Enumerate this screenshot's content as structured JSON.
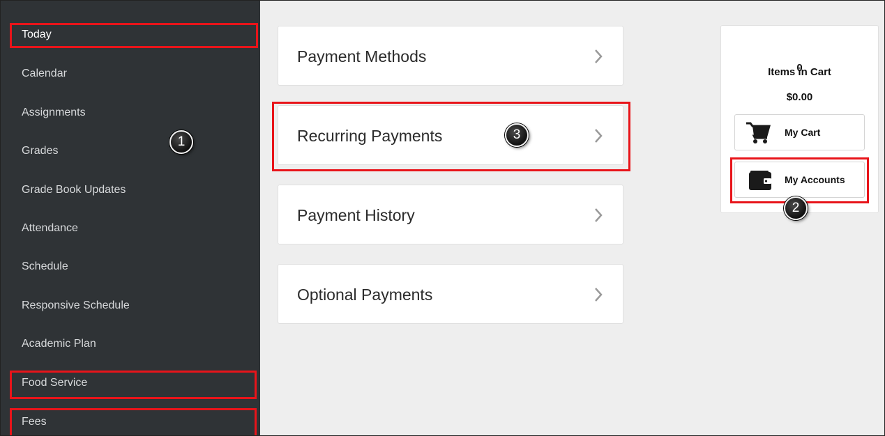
{
  "sidebar": {
    "items": [
      {
        "label": "Today"
      },
      {
        "label": "Calendar"
      },
      {
        "label": "Assignments"
      },
      {
        "label": "Grades"
      },
      {
        "label": "Grade Book Updates"
      },
      {
        "label": "Attendance"
      },
      {
        "label": "Schedule"
      },
      {
        "label": "Responsive Schedule"
      },
      {
        "label": "Academic Plan"
      },
      {
        "label": "Food Service"
      },
      {
        "label": "Fees"
      }
    ]
  },
  "payments": {
    "cards": [
      {
        "label": "Payment Methods"
      },
      {
        "label": "Recurring Payments"
      },
      {
        "label": "Payment History"
      },
      {
        "label": "Optional Payments"
      }
    ]
  },
  "cart": {
    "count": "0",
    "items_label": "Items in Cart",
    "total": "$0.00",
    "my_cart_label": "My Cart",
    "my_accounts_label": "My Accounts",
    "cart_icon": "shopping-cart-icon",
    "wallet_icon": "wallet-icon"
  },
  "markers": {
    "one": "1",
    "two": "2",
    "three": "3"
  },
  "colors": {
    "sidebar_bg": "#2f3336",
    "highlight": "#e8141a",
    "content_bg": "#eeeeee"
  }
}
